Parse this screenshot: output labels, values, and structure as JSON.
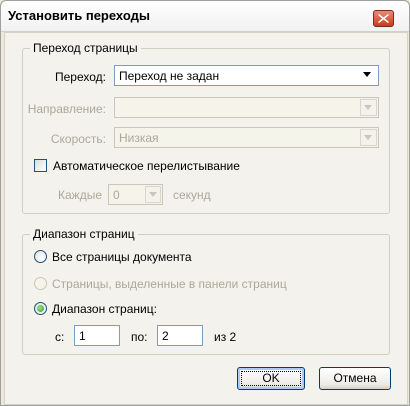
{
  "window": {
    "title": "Установить переходы"
  },
  "transition_group": {
    "legend": "Переход страницы",
    "transition_label": "Переход:",
    "transition_value": "Переход не задан",
    "direction_label": "Направление:",
    "direction_value": "",
    "speed_label": "Скорость:",
    "speed_value": "Низкая",
    "auto_flip_label": "Автоматическое перелистывание",
    "auto_flip_checked": false,
    "every_label": "Каждые",
    "every_value": "0",
    "seconds_label": "секунд"
  },
  "range_group": {
    "legend": "Диапазон страниц",
    "option_all": "Все страницы документа",
    "option_selected": "Страницы, выделенные в панели страниц",
    "option_range": "Диапазон страниц:",
    "selected_option": "range",
    "from_label": "с:",
    "from_value": "1",
    "to_label": "по:",
    "to_value": "2",
    "of_label": "из 2"
  },
  "buttons": {
    "ok": "OK",
    "cancel": "Отмена"
  },
  "colors": {
    "title_close": "#c73c1e",
    "radio_dot": "#21a121",
    "disabled_text": "#aca899"
  }
}
